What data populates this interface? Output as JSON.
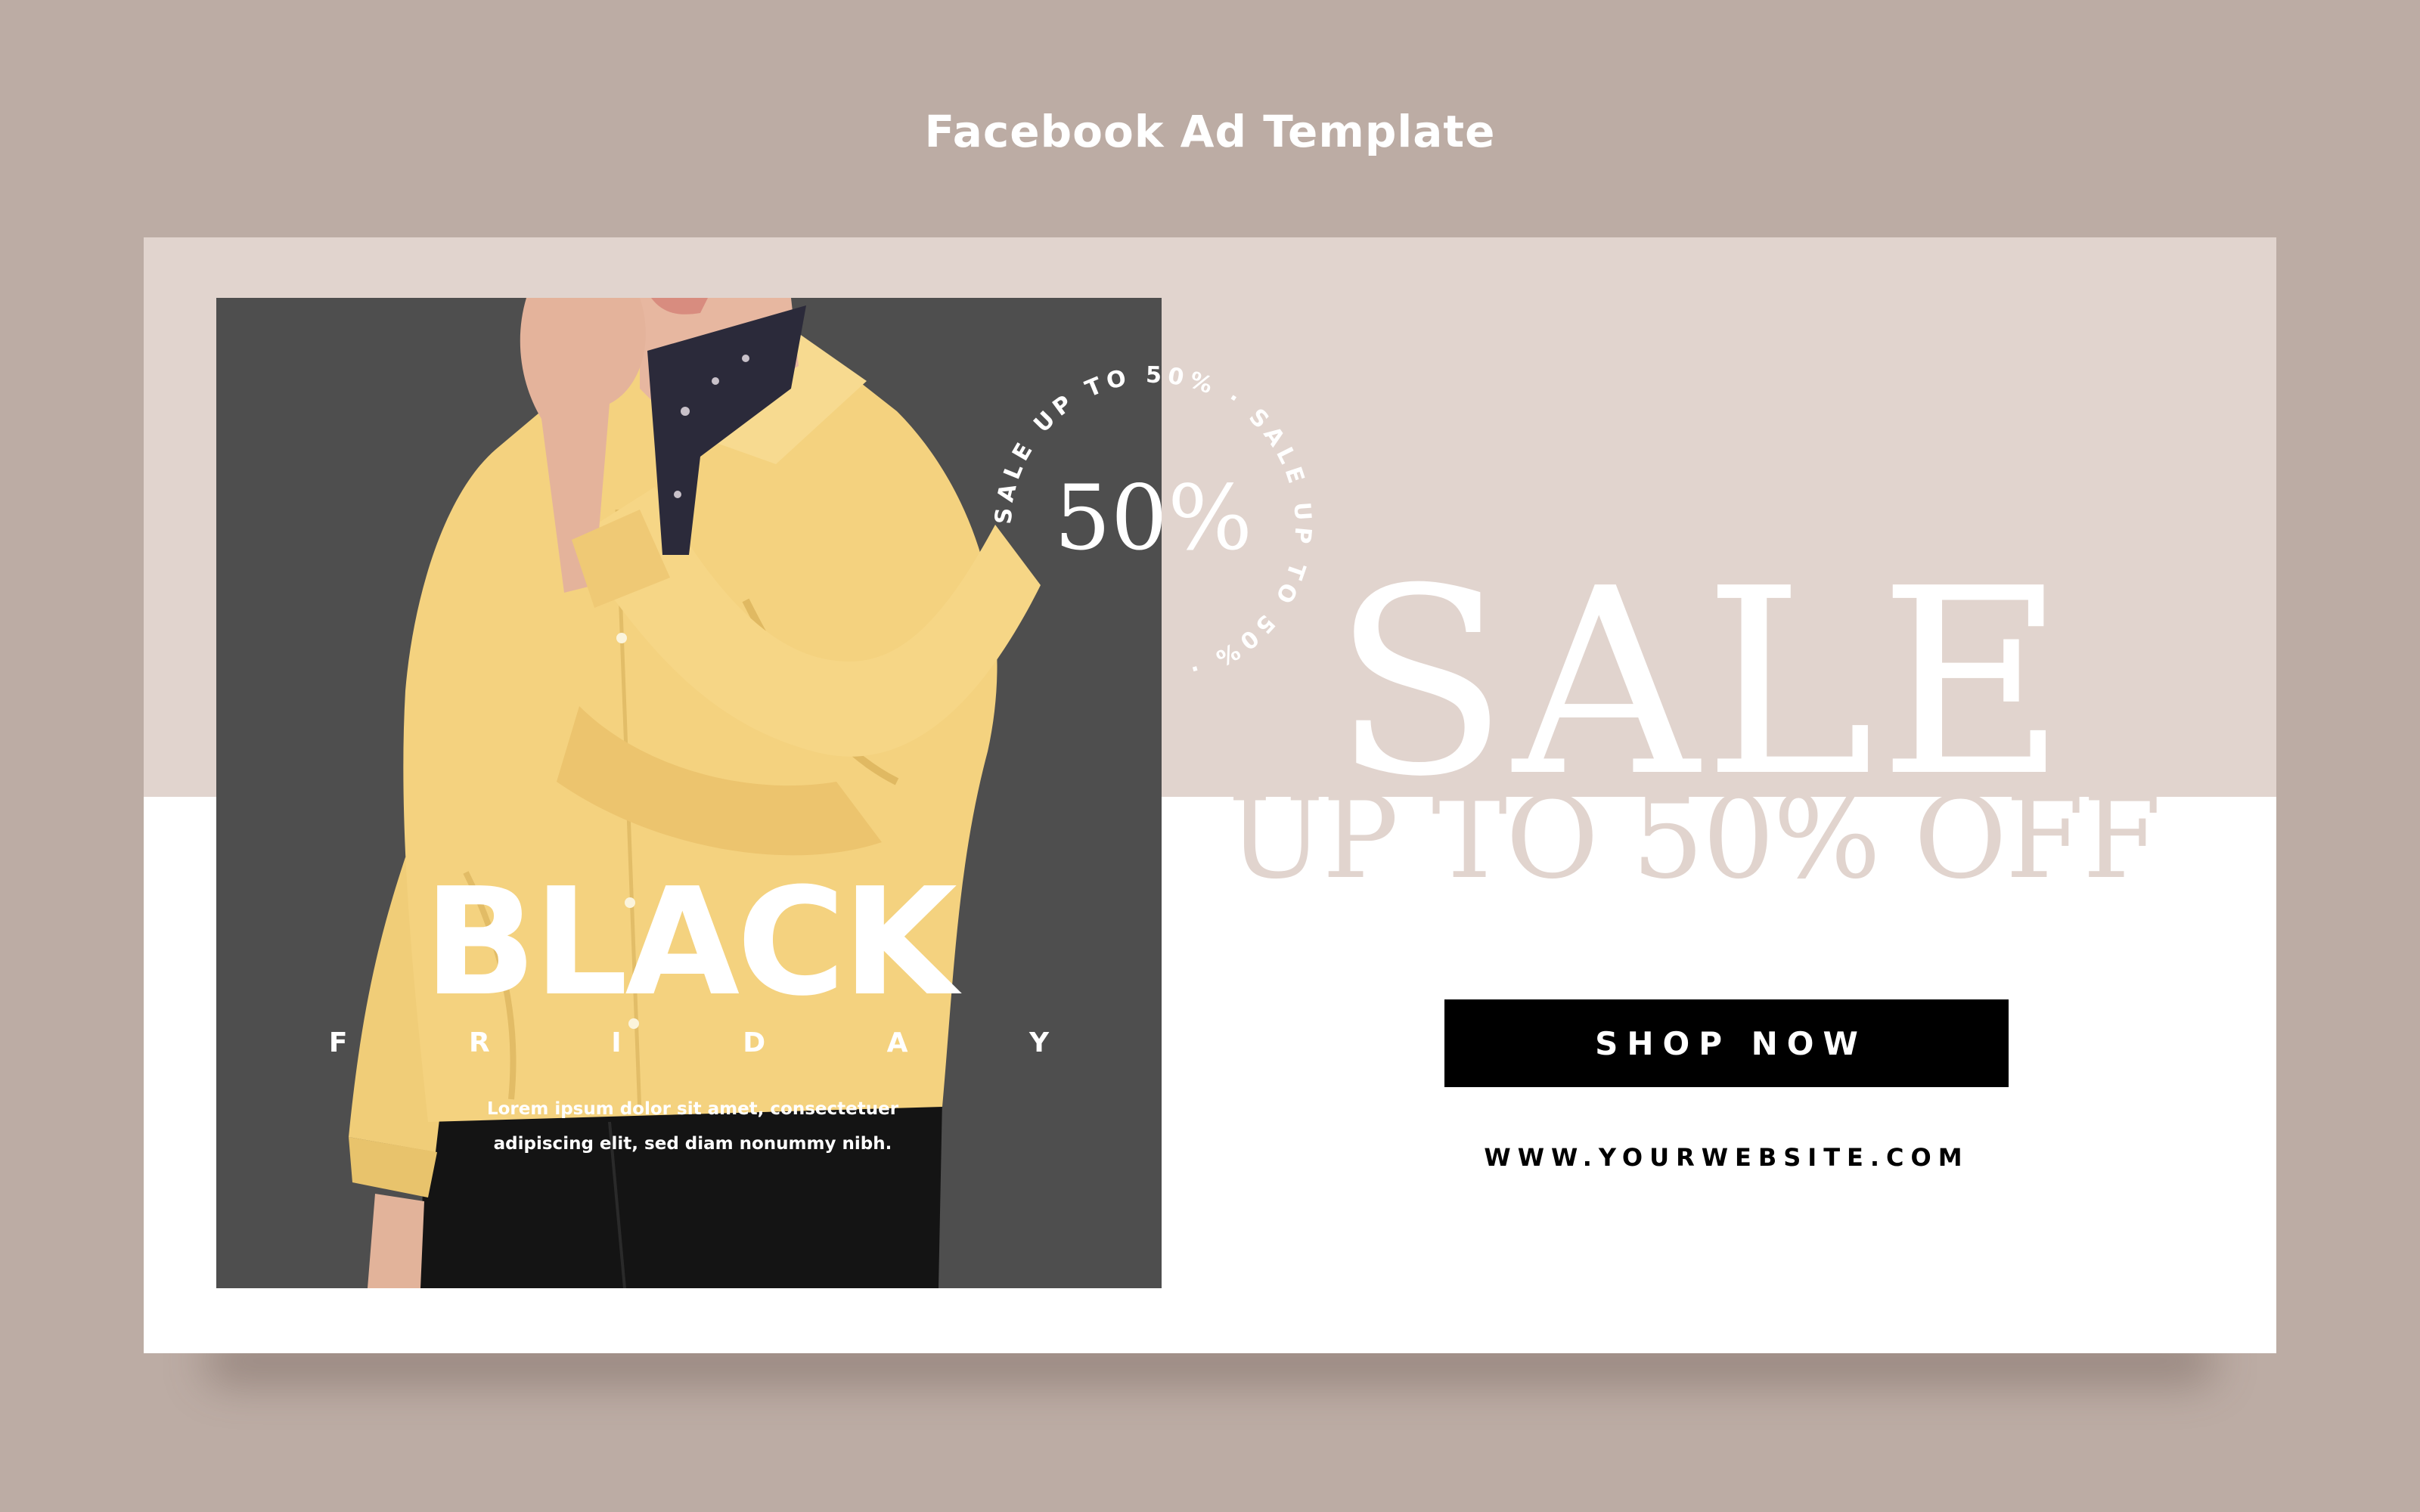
{
  "page": {
    "title": "Facebook Ad Template"
  },
  "ad": {
    "headline": "BLACK",
    "subheadline": "F R I D A Y",
    "body_line1": "Lorem ipsum dolor sit amet, consectetuer",
    "body_line2": "adipiscing elit, sed diam nonummy nibh.",
    "badge_ring_text": "SALE UP TO 50% · SALE UP TO 50% · ",
    "badge_center": "50%",
    "sale_title": "SALE",
    "sale_subtitle": "UP TO 50% OFF",
    "cta_label": "SHOP NOW",
    "website": "WWW.YOURWEBSITE.COM"
  },
  "colors": {
    "background": "#bcaca4",
    "banner_top": "#e1d4ce",
    "banner_bottom": "#ffffff",
    "photo_bg": "#4e4e4e",
    "shirt": "#f2cf7a",
    "cta_bg": "#000000"
  }
}
